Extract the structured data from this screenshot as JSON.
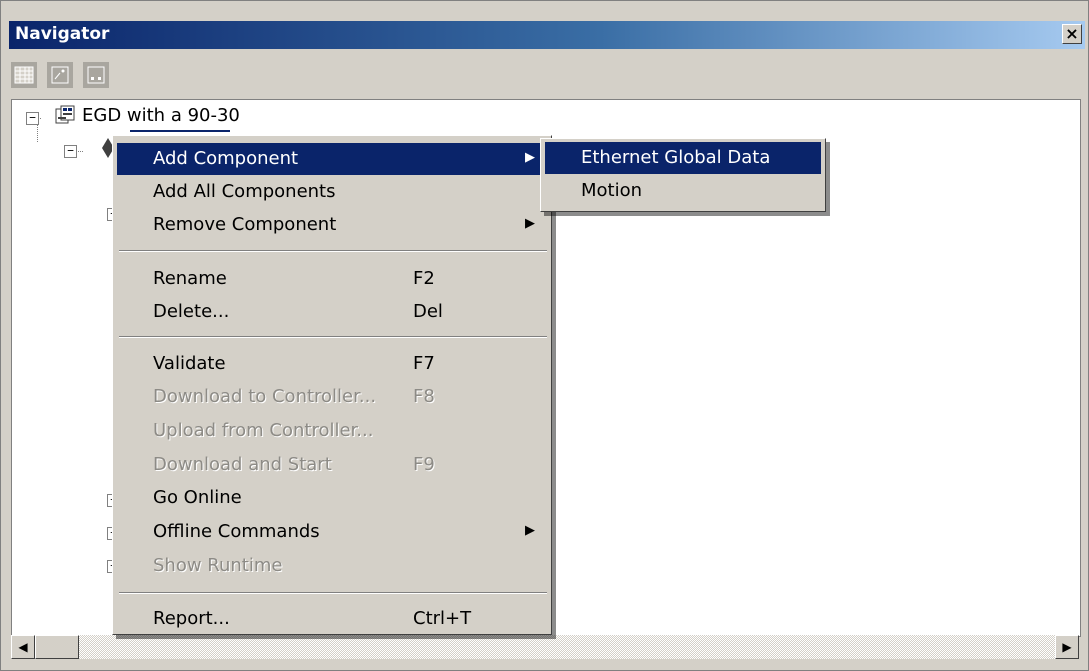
{
  "window": {
    "title": "Navigator",
    "close_glyph": "×"
  },
  "toolbar": {
    "buttons": [
      {
        "icon": "grid-view-icon"
      },
      {
        "icon": "properties-icon"
      },
      {
        "icon": "frame-view-icon"
      }
    ]
  },
  "tree": {
    "root_label": "EGD with a 90-30",
    "expander_minus": "−",
    "expander_plus": "+"
  },
  "context_menu": {
    "items": [
      {
        "label": "Add Component",
        "shortcut": "",
        "submenu": true,
        "disabled": false,
        "highlighted": true
      },
      {
        "label": "Add All Components",
        "shortcut": "",
        "submenu": false,
        "disabled": false
      },
      {
        "label": "Remove Component",
        "shortcut": "",
        "submenu": true,
        "disabled": false
      },
      {
        "label": "Rename",
        "shortcut": "F2",
        "submenu": false,
        "disabled": false
      },
      {
        "label": "Delete...",
        "shortcut": "Del",
        "submenu": false,
        "disabled": false
      },
      {
        "label": "Validate",
        "shortcut": "F7",
        "submenu": false,
        "disabled": false
      },
      {
        "label": "Download to Controller...",
        "shortcut": "F8",
        "submenu": false,
        "disabled": true
      },
      {
        "label": "Upload from Controller...",
        "shortcut": "",
        "submenu": false,
        "disabled": true
      },
      {
        "label": "Download and Start",
        "shortcut": "F9",
        "submenu": false,
        "disabled": true
      },
      {
        "label": "Go Online",
        "shortcut": "",
        "submenu": false,
        "disabled": false
      },
      {
        "label": "Offline Commands",
        "shortcut": "",
        "submenu": true,
        "disabled": false
      },
      {
        "label": "Show Runtime",
        "shortcut": "",
        "submenu": false,
        "disabled": true
      },
      {
        "label": "Report...",
        "shortcut": "Ctrl+T",
        "submenu": false,
        "disabled": false
      }
    ],
    "submenu_arrow": "▶"
  },
  "add_component_submenu": {
    "items": [
      {
        "label": "Ethernet Global Data",
        "highlighted": true
      },
      {
        "label": "Motion",
        "highlighted": false
      }
    ]
  },
  "scrollbar": {
    "left_arrow": "◀",
    "right_arrow": "▶"
  },
  "colors": {
    "highlight": "#0a246a",
    "menu_bg": "#d4d0c8",
    "disabled_text": "#8d8b86"
  }
}
